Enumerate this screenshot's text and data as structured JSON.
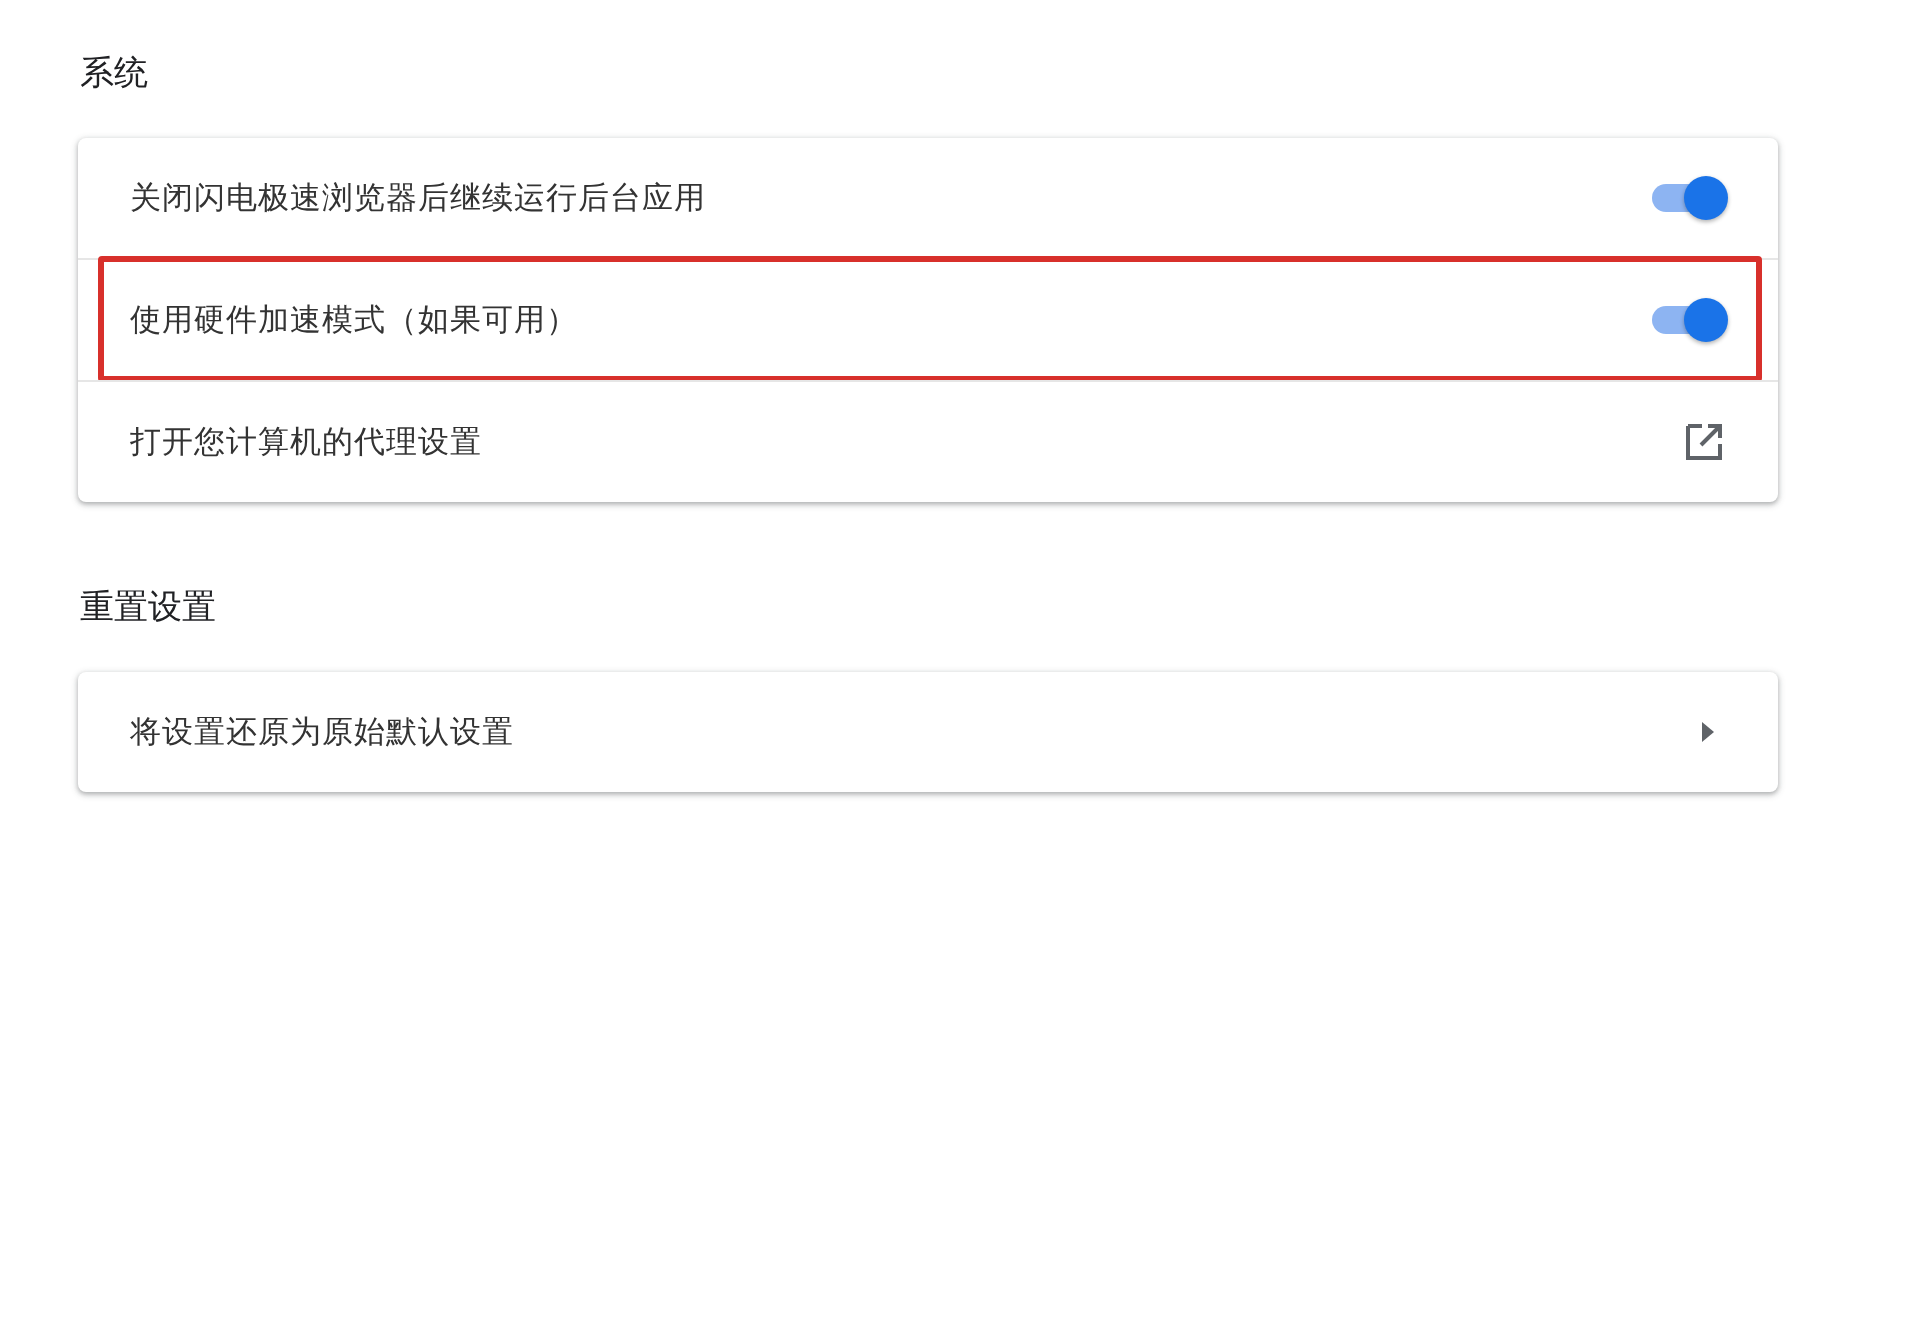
{
  "sections": [
    {
      "title": "系统",
      "rows": [
        {
          "kind": "toggle",
          "label": "关闭闪电极速浏览器后继续运行后台应用",
          "on": true,
          "highlighted": false
        },
        {
          "kind": "toggle",
          "label": "使用硬件加速模式（如果可用）",
          "on": true,
          "highlighted": true
        },
        {
          "kind": "external",
          "label": "打开您计算机的代理设置",
          "highlighted": false
        }
      ]
    },
    {
      "title": "重置设置",
      "rows": [
        {
          "kind": "submenu",
          "label": "将设置还原为原始默认设置",
          "highlighted": false
        }
      ]
    }
  ]
}
